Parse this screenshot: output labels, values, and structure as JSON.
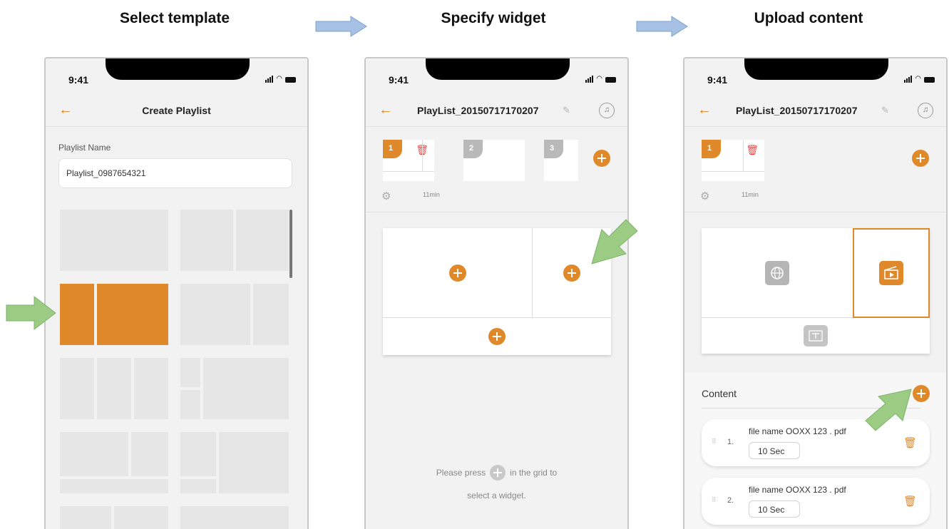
{
  "steps": [
    "Select template",
    "Specify widget",
    "Upload content"
  ],
  "status": {
    "time": "9:41"
  },
  "phone1": {
    "title": "Create Playlist",
    "field_label": "Playlist Name",
    "field_value": "Playlist_0987654321"
  },
  "phone2": {
    "title": "PlayList_20150717170207",
    "thumbs": [
      "1",
      "2",
      "3"
    ],
    "duration": "11min",
    "hint_before": "Please press",
    "hint_after": "in the grid to",
    "hint_line2": "select a widget."
  },
  "phone3": {
    "title": "PlayList_20150717170207",
    "thumbs": [
      "1"
    ],
    "duration": "11min",
    "content_label": "Content",
    "files": [
      {
        "index": "1.",
        "name": "file name OOXX 123 . pdf",
        "duration": "10 Sec"
      },
      {
        "index": "2.",
        "name": "file name OOXX 123 . pdf",
        "duration": "10 Sec"
      }
    ]
  },
  "colors": {
    "accent": "#e0892a",
    "arrow_green": "#9ccc84",
    "arrow_blue": "#a7c1e4",
    "delete_red": "#e24a4a"
  },
  "icons": [
    "back-arrow-icon",
    "pencil-icon",
    "music-note-icon",
    "gear-icon",
    "trash-icon",
    "plus-icon",
    "globe-icon",
    "video-icon",
    "text-icon",
    "drag-handle-icon",
    "signal-icon",
    "wifi-icon",
    "battery-icon"
  ]
}
